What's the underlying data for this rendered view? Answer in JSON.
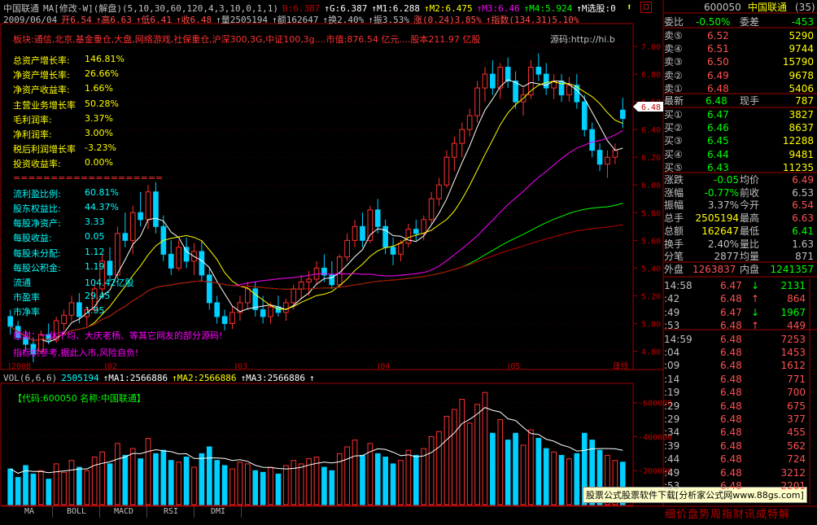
{
  "header": {
    "line1": [
      {
        "t": "中国联通",
        "c": "#c0c0c0"
      },
      {
        "t": "MA[修改-W](解盘)(5,10,30,60,120,4,3,10,0,1,1)",
        "c": "#c0c0c0"
      },
      {
        "t": "B:6.387",
        "c": "#c00000"
      },
      {
        "t": "↑G:6.387",
        "c": "#ffffff"
      },
      {
        "t": "↑M1:6.288",
        "c": "#ffffff"
      },
      {
        "t": "↑M2:6.475",
        "c": "#ffff00"
      },
      {
        "t": "↑M3:6.46",
        "c": "#ff00ff"
      },
      {
        "t": "↑M4:5.924",
        "c": "#00ff00"
      },
      {
        "t": "↑M选股:0",
        "c": "#ffffff"
      }
    ],
    "line2": [
      {
        "t": "2009/06/04",
        "c": "#c0c0c0"
      },
      {
        "t": "开6.54",
        "c": "#ff5050"
      },
      {
        "t": "↑高6.63",
        "c": "#ff5050"
      },
      {
        "t": "↑低6.41",
        "c": "#ff5050"
      },
      {
        "t": "↑收6.48",
        "c": "#ff5050"
      },
      {
        "t": "↑量2505194",
        "c": "#c0c0c0"
      },
      {
        "t": "↑额162647",
        "c": "#c0c0c0"
      },
      {
        "t": "↑换2.40%",
        "c": "#c0c0c0"
      },
      {
        "t": "↑振3.53%",
        "c": "#c0c0c0"
      },
      {
        "t": "涨(0.24)3.85%",
        "c": "#ff5050"
      },
      {
        "t": "↑指数(134.31)5.10%",
        "c": "#ff5050"
      }
    ],
    "sector_line": "板块:通信,北京,基金重仓,大盘,网络游戏,社保重仓,沪深300,3G,中证100,3g....市值:876.54 亿元....股本211.97 亿股",
    "source_label": "源码:http://hi.b"
  },
  "fundamentals": [
    {
      "label": "总资产增长率:",
      "value": "146.81%",
      "color": "#ffff00"
    },
    {
      "label": "净资产增长率:",
      "value": "26.66%",
      "color": "#ffff00"
    },
    {
      "label": "净资产收益率:",
      "value": "1.66%",
      "color": "#ffff00"
    },
    {
      "label": "主营业务增长率",
      "value": "50.28%",
      "color": "#ffff00"
    },
    {
      "label": "毛利润率:",
      "value": "3.37%",
      "color": "#ffff00"
    },
    {
      "label": "净利润率:",
      "value": "3.00%",
      "color": "#ffff00"
    },
    {
      "label": "税后利润增长率",
      "value": "-3.23%",
      "color": "#ffff00"
    },
    {
      "label": "投资收益率:",
      "value": "0.00%",
      "color": "#ffff00"
    },
    {
      "label": "====================",
      "value": "",
      "color": "#ff3030"
    },
    {
      "label": "流利盈比例:",
      "value": "60.81%",
      "color": "#00ffff"
    },
    {
      "label": "股东权益比:",
      "value": "44.37%",
      "color": "#00ffff"
    },
    {
      "label": "每股净资产:",
      "value": "3.33",
      "color": "#00ffff"
    },
    {
      "label": "每股收益:",
      "value": "0.05",
      "color": "#00ffff"
    },
    {
      "label": "每股未分配:",
      "value": "1.12",
      "color": "#00ffff"
    },
    {
      "label": "每股公积金:",
      "value": "1.19",
      "color": "#00ffff"
    },
    {
      "label": "流通",
      "value": "104.42亿股",
      "color": "#00ffff"
    },
    {
      "label": "市盈率",
      "value": "29.45",
      "color": "#00ffff"
    },
    {
      "label": "市净率",
      "value": "1.95",
      "color": "#00ffff"
    }
  ],
  "thanks_line": "感谢：一休千均、大庆老杨、等其它网友的部分源码!",
  "disclaimer_line": "指标供参考,据此入市,风险自负!",
  "price_axis": [
    "7.00",
    "6.80",
    "6.60",
    "6.40",
    "6.20",
    "6.00",
    "5.80",
    "5.60",
    "5.40",
    "5.20",
    "5.00",
    "4.80"
  ],
  "price_tag": "6.48",
  "date_axis": [
    "2008",
    "02",
    "03",
    "04",
    "05",
    "日线"
  ],
  "volume_header": [
    {
      "t": "VOL(6,6,6)",
      "c": "#c0c0c0"
    },
    {
      "t": "2505194",
      "c": "#00ffff"
    },
    {
      "t": "↑MA1:2566886",
      "c": "#ffffff"
    },
    {
      "t": "↑MA2:2566886",
      "c": "#ffff00"
    },
    {
      "t": "↑MA3:2566886",
      "c": "#ffffff"
    },
    {
      "t": "↑",
      "c": "#ffffff"
    }
  ],
  "volume_info": "【代码:600050 名称:中国联通】",
  "volume_axis": [
    "600000",
    "400000",
    "200000"
  ],
  "banner": "股票公式股票软件下载[分析家公式网www.88gs.com]",
  "bottom_tabs": [
    "MA",
    "BOLL",
    "MACD",
    "RSI",
    "DMI"
  ],
  "bottom_right_tabs": "细价盘势周指财讯成特解",
  "quote": {
    "code": "600050",
    "name": "中国联通",
    "count": "(35)",
    "weibi_label": "委比",
    "weibi_value": "-0.50%",
    "weicha_label": "委差",
    "weicha_value": "-453",
    "asks": [
      {
        "label": "卖⑤",
        "price": "6.52",
        "vol": "5290"
      },
      {
        "label": "卖④",
        "price": "6.51",
        "vol": "9744"
      },
      {
        "label": "卖③",
        "price": "6.50",
        "vol": "15790"
      },
      {
        "label": "卖②",
        "price": "6.49",
        "vol": "9678"
      },
      {
        "label": "卖①",
        "price": "6.48",
        "vol": "5406"
      }
    ],
    "latest_label": "最新",
    "latest": "6.48",
    "xianshou_label": "现手",
    "xianshou": "787",
    "bids": [
      {
        "label": "买①",
        "price": "6.47",
        "vol": "3827"
      },
      {
        "label": "买②",
        "price": "6.46",
        "vol": "8637"
      },
      {
        "label": "买③",
        "price": "6.45",
        "vol": "12288"
      },
      {
        "label": "买④",
        "price": "6.44",
        "vol": "9481"
      },
      {
        "label": "买⑤",
        "price": "6.43",
        "vol": "11235"
      }
    ],
    "stats": [
      {
        "l1": "涨跌",
        "v1": "-0.05",
        "c1": "#00ff00",
        "l2": "均价",
        "v2": "6.49",
        "c2": "#ff5050"
      },
      {
        "l1": "涨幅",
        "v1": "-0.77%",
        "c1": "#00ff00",
        "l2": "前收",
        "v2": "6.53",
        "c2": "#c0c0c0"
      },
      {
        "l1": "振幅",
        "v1": "3.37%",
        "c1": "#c0c0c0",
        "l2": "今开",
        "v2": "6.54",
        "c2": "#ff5050"
      },
      {
        "l1": "总手",
        "v1": "2505194",
        "c1": "#ffff00",
        "l2": "最高",
        "v2": "6.63",
        "c2": "#ff5050"
      },
      {
        "l1": "总额",
        "v1": "162647",
        "c1": "#ffff00",
        "l2": "最低",
        "v2": "6.41",
        "c2": "#00ff00"
      },
      {
        "l1": "换手",
        "v1": "2.40%",
        "c1": "#c0c0c0",
        "l2": "量比",
        "v2": "1.63",
        "c2": "#c0c0c0"
      },
      {
        "l1": "分笔",
        "v1": "2877",
        "c1": "#c0c0c0",
        "l2": "均量",
        "v2": "871",
        "c2": "#c0c0c0"
      }
    ],
    "outer_label": "外盘",
    "outer": "1263837",
    "inner_label": "内盘",
    "inner": "1241357",
    "ticks": [
      {
        "t": "14:58",
        "p": "6.47",
        "a": "↓",
        "v": "2131",
        "vc": "#00ff00"
      },
      {
        "t": ":42",
        "p": "6.48",
        "a": "↑",
        "v": "864",
        "vc": "#ff5050"
      },
      {
        "t": ":49",
        "p": "6.47",
        "a": "↓",
        "v": "1967",
        "vc": "#00ff00"
      },
      {
        "t": ":53",
        "p": "6.48",
        "a": "↑",
        "v": "449",
        "vc": "#ff5050"
      },
      {
        "t": "14:59",
        "p": "6.48",
        "a": "",
        "v": "7253",
        "vc": "#ff5050"
      },
      {
        "t": ":04",
        "p": "6.48",
        "a": "",
        "v": "1453",
        "vc": "#ff5050"
      },
      {
        "t": ":09",
        "p": "6.48",
        "a": "",
        "v": "1612",
        "vc": "#ff5050"
      },
      {
        "t": ":14",
        "p": "6.48",
        "a": "",
        "v": "771",
        "vc": "#ff5050"
      },
      {
        "t": ":19",
        "p": "6.48",
        "a": "",
        "v": "700",
        "vc": "#ff5050"
      },
      {
        "t": ":29",
        "p": "6.48",
        "a": "",
        "v": "675",
        "vc": "#ff5050"
      },
      {
        "t": ":29",
        "p": "6.48",
        "a": "",
        "v": "377",
        "vc": "#ff5050"
      },
      {
        "t": ":34",
        "p": "6.48",
        "a": "",
        "v": "455",
        "vc": "#ff5050"
      },
      {
        "t": ":39",
        "p": "6.48",
        "a": "",
        "v": "562",
        "vc": "#ff5050"
      },
      {
        "t": ":44",
        "p": "6.48",
        "a": "",
        "v": "724",
        "vc": "#ff5050"
      },
      {
        "t": ":49",
        "p": "6.48",
        "a": "",
        "v": "3212",
        "vc": "#ff5050"
      },
      {
        "t": ":53",
        "p": "6.48",
        "a": "",
        "v": "2201",
        "vc": "#ff5050"
      }
    ]
  },
  "chart_data": {
    "type": "candlestick",
    "ylim": [
      4.75,
      7.1
    ],
    "vol_ylim": [
      0,
      680000
    ],
    "colors": {
      "up": "#ff3030",
      "down": "#00d0ff",
      "ma5": "#ffffff",
      "ma10": "#ffff00",
      "ma30": "#ff00ff",
      "ma60": "#00ff00",
      "ma120": "#c00000"
    },
    "candles": [
      [
        5.05,
        5.1,
        4.92,
        4.98
      ],
      [
        4.98,
        5.02,
        4.88,
        4.9
      ],
      [
        4.9,
        4.95,
        4.8,
        4.85
      ],
      [
        4.85,
        4.9,
        4.72,
        4.78
      ],
      [
        4.8,
        4.95,
        4.78,
        4.92
      ],
      [
        4.92,
        5.0,
        4.85,
        4.88
      ],
      [
        4.88,
        5.05,
        4.86,
        5.02
      ],
      [
        5.0,
        5.1,
        4.95,
        5.06
      ],
      [
        5.06,
        5.2,
        5.02,
        5.15
      ],
      [
        5.15,
        5.22,
        5.0,
        5.05
      ],
      [
        5.05,
        5.12,
        4.98,
        5.1
      ],
      [
        5.1,
        5.3,
        5.08,
        5.25
      ],
      [
        5.25,
        5.5,
        5.2,
        5.45
      ],
      [
        5.45,
        5.55,
        5.3,
        5.35
      ],
      [
        5.35,
        5.7,
        5.32,
        5.65
      ],
      [
        5.65,
        5.8,
        5.55,
        5.6
      ],
      [
        5.6,
        5.85,
        5.5,
        5.8
      ],
      [
        5.8,
        5.95,
        5.7,
        5.75
      ],
      [
        5.75,
        6.0,
        5.68,
        5.95
      ],
      [
        5.95,
        6.02,
        5.65,
        5.7
      ],
      [
        5.7,
        5.78,
        5.45,
        5.5
      ],
      [
        5.5,
        5.6,
        5.35,
        5.4
      ],
      [
        5.4,
        5.6,
        5.38,
        5.55
      ],
      [
        5.55,
        5.62,
        5.4,
        5.45
      ],
      [
        5.45,
        5.58,
        5.35,
        5.52
      ],
      [
        5.52,
        5.6,
        5.3,
        5.35
      ],
      [
        5.35,
        5.4,
        5.1,
        5.15
      ],
      [
        5.15,
        5.2,
        5.0,
        5.05
      ],
      [
        5.05,
        5.1,
        4.95,
        5.0
      ],
      [
        5.0,
        5.12,
        4.96,
        5.08
      ],
      [
        5.08,
        5.2,
        5.02,
        5.15
      ],
      [
        5.15,
        5.3,
        5.1,
        5.25
      ],
      [
        5.25,
        5.3,
        5.05,
        5.1
      ],
      [
        5.1,
        5.2,
        5.0,
        5.05
      ],
      [
        5.05,
        5.15,
        5.0,
        5.12
      ],
      [
        5.12,
        5.2,
        5.05,
        5.08
      ],
      [
        5.08,
        5.18,
        5.02,
        5.15
      ],
      [
        5.15,
        5.28,
        5.1,
        5.25
      ],
      [
        5.25,
        5.35,
        5.18,
        5.3
      ],
      [
        5.3,
        5.38,
        5.2,
        5.32
      ],
      [
        5.32,
        5.45,
        5.28,
        5.4
      ],
      [
        5.4,
        5.5,
        5.3,
        5.35
      ],
      [
        5.35,
        5.45,
        5.25,
        5.28
      ],
      [
        5.28,
        5.5,
        5.26,
        5.48
      ],
      [
        5.48,
        5.65,
        5.45,
        5.6
      ],
      [
        5.6,
        5.75,
        5.55,
        5.7
      ],
      [
        5.7,
        5.8,
        5.55,
        5.6
      ],
      [
        5.6,
        5.85,
        5.58,
        5.82
      ],
      [
        5.82,
        5.9,
        5.65,
        5.7
      ],
      [
        5.7,
        5.75,
        5.5,
        5.55
      ],
      [
        5.55,
        5.62,
        5.42,
        5.5
      ],
      [
        5.5,
        5.6,
        5.45,
        5.58
      ],
      [
        5.58,
        5.72,
        5.55,
        5.68
      ],
      [
        5.68,
        5.75,
        5.6,
        5.65
      ],
      [
        5.65,
        5.78,
        5.6,
        5.75
      ],
      [
        5.75,
        5.95,
        5.72,
        5.9
      ],
      [
        5.9,
        6.05,
        5.85,
        6.0
      ],
      [
        6.0,
        6.25,
        5.98,
        6.2
      ],
      [
        6.2,
        6.35,
        6.1,
        6.3
      ],
      [
        6.3,
        6.45,
        6.2,
        6.4
      ],
      [
        6.4,
        6.55,
        6.35,
        6.5
      ],
      [
        6.5,
        6.75,
        6.45,
        6.7
      ],
      [
        6.7,
        6.85,
        6.6,
        6.8
      ],
      [
        6.8,
        6.9,
        6.65,
        6.7
      ],
      [
        6.7,
        6.88,
        6.62,
        6.85
      ],
      [
        6.85,
        6.92,
        6.7,
        6.75
      ],
      [
        6.75,
        6.82,
        6.55,
        6.6
      ],
      [
        6.6,
        6.7,
        6.5,
        6.65
      ],
      [
        6.65,
        6.9,
        6.62,
        6.85
      ],
      [
        6.85,
        6.95,
        6.75,
        6.8
      ],
      [
        6.8,
        6.88,
        6.65,
        6.7
      ],
      [
        6.7,
        6.8,
        6.62,
        6.75
      ],
      [
        6.75,
        6.8,
        6.6,
        6.65
      ],
      [
        6.65,
        6.78,
        6.6,
        6.72
      ],
      [
        6.72,
        6.8,
        6.55,
        6.6
      ],
      [
        6.6,
        6.65,
        6.35,
        6.4
      ],
      [
        6.4,
        6.45,
        6.2,
        6.25
      ],
      [
        6.25,
        6.3,
        6.1,
        6.15
      ],
      [
        6.15,
        6.25,
        6.05,
        6.2
      ],
      [
        6.2,
        6.3,
        6.15,
        6.25
      ],
      [
        6.54,
        6.63,
        6.41,
        6.48
      ]
    ],
    "volumes": [
      210000,
      160000,
      230000,
      180000,
      200000,
      150000,
      240000,
      190000,
      260000,
      220000,
      200000,
      280000,
      310000,
      240000,
      360000,
      290000,
      330000,
      270000,
      390000,
      300000,
      320000,
      260000,
      250000,
      280000,
      220000,
      300000,
      340000,
      260000,
      230000,
      210000,
      250000,
      240000,
      200000,
      190000,
      220000,
      180000,
      230000,
      260000,
      240000,
      270000,
      280000,
      220000,
      200000,
      300000,
      340000,
      380000,
      290000,
      360000,
      300000,
      280000,
      240000,
      260000,
      320000,
      290000,
      330000,
      400000,
      430000,
      520000,
      560000,
      620000,
      480000,
      590000,
      660000,
      420000,
      500000,
      380000,
      420000,
      350000,
      440000,
      390000,
      330000,
      310000,
      290000,
      270000,
      300000,
      420000,
      380000,
      320000,
      290000,
      260000,
      250000
    ]
  }
}
